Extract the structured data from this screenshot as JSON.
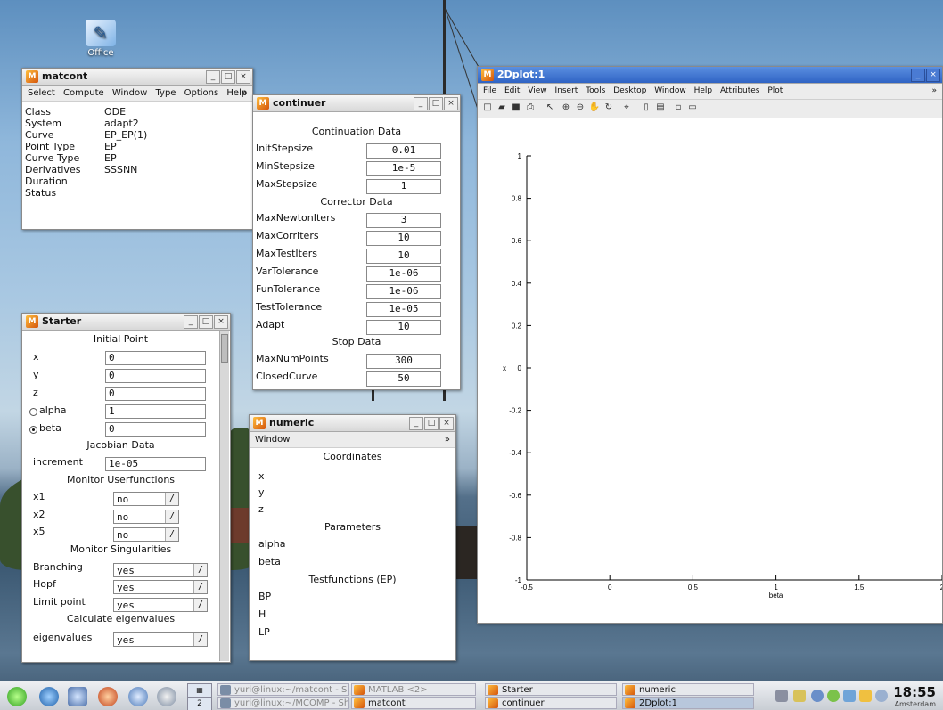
{
  "desktop": {
    "icon_label": "Office"
  },
  "matcont": {
    "title": "matcont",
    "menu": [
      "Select",
      "Compute",
      "Window",
      "Type",
      "Options",
      "Help"
    ],
    "rows": [
      {
        "label": "Class",
        "value": "ODE"
      },
      {
        "label": "System",
        "value": "adapt2"
      },
      {
        "label": "Curve",
        "value": "EP_EP(1)"
      },
      {
        "label": "Point Type",
        "value": "EP"
      },
      {
        "label": "Curve Type",
        "value": "EP"
      },
      {
        "label": "Derivatives",
        "value": "SSSNN"
      },
      {
        "label": "Duration",
        "value": ""
      },
      {
        "label": "Status",
        "value": ""
      }
    ]
  },
  "continuer": {
    "title": "continuer",
    "section_continuation": "Continuation Data",
    "section_corrector": "Corrector Data",
    "section_stop": "Stop Data",
    "continuation": [
      {
        "label": "InitStepsize",
        "value": "0.01"
      },
      {
        "label": "MinStepsize",
        "value": "1e-5"
      },
      {
        "label": "MaxStepsize",
        "value": "1"
      }
    ],
    "corrector": [
      {
        "label": "MaxNewtonIters",
        "value": "3"
      },
      {
        "label": "MaxCorrIters",
        "value": "10"
      },
      {
        "label": "MaxTestIters",
        "value": "10"
      },
      {
        "label": "VarTolerance",
        "value": "1e-06"
      },
      {
        "label": "FunTolerance",
        "value": "1e-06"
      },
      {
        "label": "TestTolerance",
        "value": "1e-05"
      },
      {
        "label": "Adapt",
        "value": "10"
      }
    ],
    "stop": [
      {
        "label": "MaxNumPoints",
        "value": "300"
      },
      {
        "label": "ClosedCurve",
        "value": "50"
      }
    ]
  },
  "starter": {
    "title": "Starter",
    "section_initial": "Initial Point",
    "initial": [
      {
        "label": "x",
        "value": "0"
      },
      {
        "label": "y",
        "value": "0"
      },
      {
        "label": "z",
        "value": "0"
      }
    ],
    "alpha_label": "alpha",
    "alpha_value": "1",
    "beta_label": "beta",
    "beta_value": "0",
    "active_parameter": "beta",
    "section_jacobian": "Jacobian Data",
    "increment_label": "increment",
    "increment_value": "1e-05",
    "section_monitor_user": "Monitor Userfunctions",
    "userfunctions": [
      {
        "label": "x1",
        "value": "no"
      },
      {
        "label": "x2",
        "value": "no"
      },
      {
        "label": "x5",
        "value": "no"
      }
    ],
    "section_monitor_sing": "Monitor Singularities",
    "singularities": [
      {
        "label": "Branching",
        "value": "yes"
      },
      {
        "label": "Hopf",
        "value": "yes"
      },
      {
        "label": "Limit point",
        "value": "yes"
      }
    ],
    "section_eigen": "Calculate eigenvalues",
    "eigen_label": "eigenvalues",
    "eigen_value": "yes"
  },
  "numeric": {
    "title": "numeric",
    "menu": "Window",
    "section_coords": "Coordinates",
    "coords": [
      "x",
      "y",
      "z"
    ],
    "section_params": "Parameters",
    "params": [
      "alpha",
      "beta"
    ],
    "section_tests": "Testfunctions (EP)",
    "tests": [
      "BP",
      "H",
      "LP"
    ]
  },
  "plot": {
    "title": "2Dplot:1",
    "menu": [
      "File",
      "Edit",
      "View",
      "Insert",
      "Tools",
      "Desktop",
      "Window",
      "Help",
      "Attributes",
      "Plot"
    ],
    "ylabel": "x",
    "xlabel": "beta"
  },
  "chart_data": {
    "type": "line",
    "title": "",
    "xlabel": "beta",
    "ylabel": "x",
    "xlim": [
      -0.5,
      2
    ],
    "ylim": [
      -1,
      1
    ],
    "x_ticks": [
      "-0.5",
      "0",
      "0.5",
      "1",
      "1.5",
      "2"
    ],
    "y_ticks": [
      "1",
      "0.8",
      "0.6",
      "0.4",
      "0.2",
      "0",
      "-0.2",
      "-0.4",
      "-0.6",
      "-0.8",
      "-1"
    ],
    "series": []
  },
  "taskbar": {
    "tasks": [
      {
        "label": "yuri@linux:~/matcont - She",
        "kind": "term",
        "dim": true
      },
      {
        "label": "yuri@linux:~/MCOMP - She",
        "kind": "term",
        "dim": true
      },
      {
        "label": "MATLAB <2>",
        "kind": "matlab",
        "dim": true
      },
      {
        "label": "matcont",
        "kind": "matlab",
        "dim": false
      },
      {
        "label": "Starter",
        "kind": "matlab",
        "dim": false
      },
      {
        "label": "continuer",
        "kind": "matlab",
        "dim": false
      },
      {
        "label": "numeric",
        "kind": "matlab",
        "dim": false
      },
      {
        "label": "2Dplot:1",
        "kind": "matlab",
        "dim": false
      }
    ],
    "desktop_num": "2",
    "clock": "18:55",
    "clock_city": "Amsterdam"
  }
}
